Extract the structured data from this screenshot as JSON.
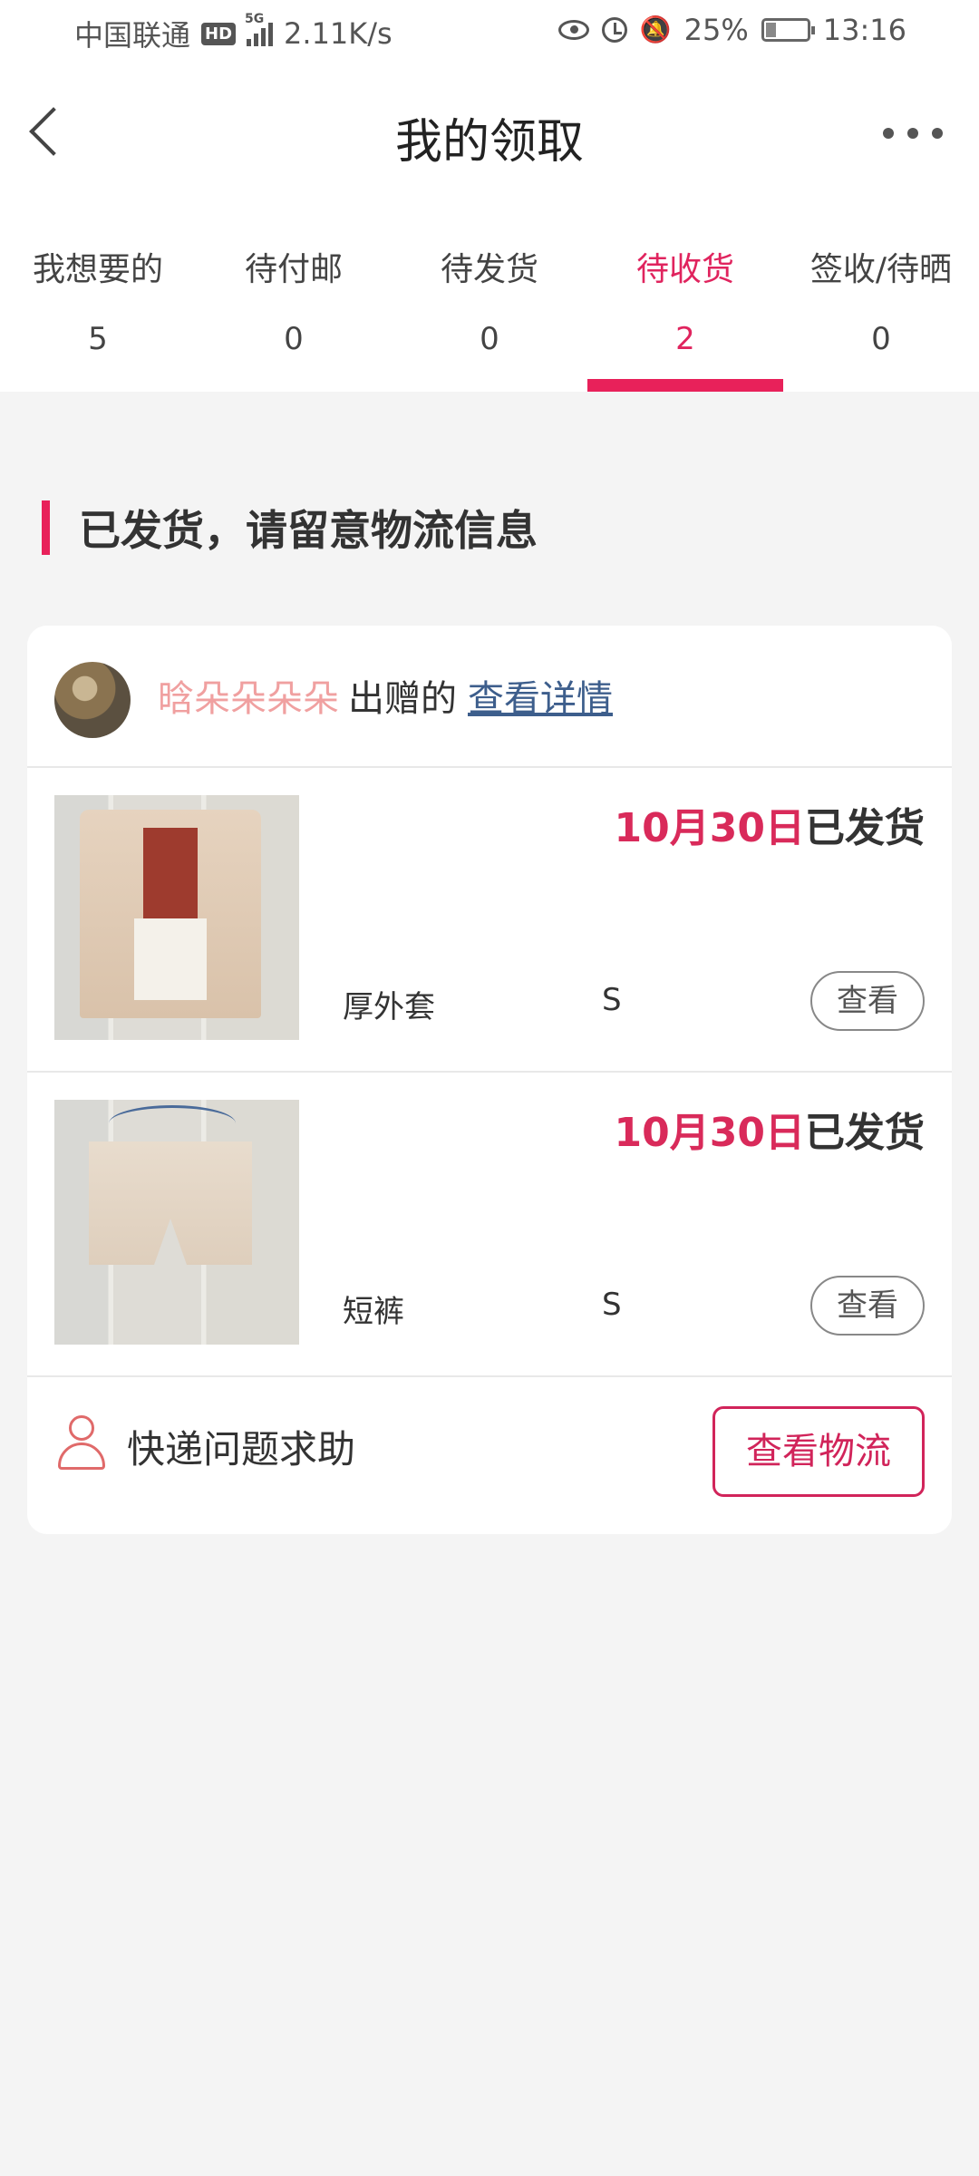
{
  "status_bar": {
    "carrier": "中国联通",
    "hd": "HD",
    "network": "5G",
    "speed": "2.11K/s",
    "battery": "25%",
    "battery_level": 0.25,
    "time": "13:16"
  },
  "header": {
    "title": "我的领取"
  },
  "tabs": [
    {
      "label": "我想要的",
      "count": "5",
      "active": false
    },
    {
      "label": "待付邮",
      "count": "0",
      "active": false
    },
    {
      "label": "待发货",
      "count": "0",
      "active": false
    },
    {
      "label": "待收货",
      "count": "2",
      "active": true
    },
    {
      "label": "签收/待晒",
      "count": "0",
      "active": false
    }
  ],
  "section": {
    "title": "已发货，请留意物流信息"
  },
  "order": {
    "giver_name": "晗朵朵朵朵",
    "giver_suffix": "出赠的",
    "details_link": "查看详情",
    "items": [
      {
        "date": "10月30日",
        "status": "已发货",
        "name": "厚外套",
        "size": "S",
        "view_label": "查看"
      },
      {
        "date": "10月30日",
        "status": "已发货",
        "name": "短裤",
        "size": "S",
        "view_label": "查看"
      }
    ],
    "help_label": "快递问题求助",
    "logistics_label": "查看物流"
  },
  "colors": {
    "accent": "#e8215a",
    "giver_name": "#f0a0a0",
    "link": "#3d5e8c"
  }
}
